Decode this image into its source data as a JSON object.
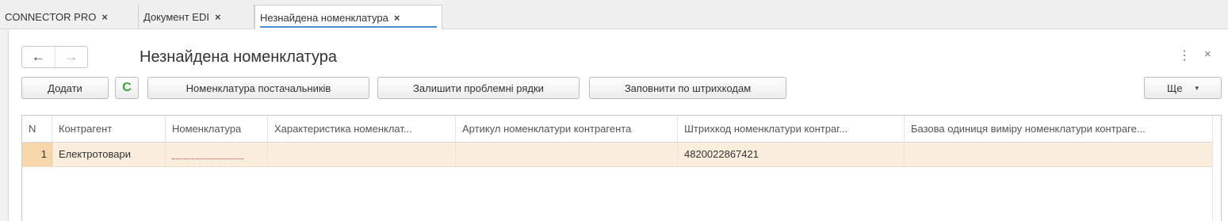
{
  "tabs": [
    {
      "label": "CONNECTOR PRO",
      "close": "×"
    },
    {
      "label": "Документ EDI",
      "close": "×"
    },
    {
      "label": "Незнайдена номенклатура",
      "close": "×"
    }
  ],
  "form": {
    "title": "Незнайдена номенклатура",
    "nav_back": "←",
    "nav_forward": "→",
    "menu_icon": "⋮",
    "close_icon": "×"
  },
  "toolbar": {
    "add": "Додати",
    "refresh_icon": "C",
    "supplier_nomenclature": "Номенклатура постачальників",
    "keep_problem_rows": "Залишити проблемні рядки",
    "fill_by_barcodes": "Заповнити по штрихкодам",
    "more": "Ще",
    "more_caret": "▾"
  },
  "table": {
    "columns": [
      "N",
      "Контрагент",
      "Номенклатура",
      "Характеристика номенклат...",
      "Артикул номенклатури контрагента",
      "Штрихкод номенклатури контраг...",
      "Базова одиниця виміру номенклатури контраге..."
    ],
    "rows": [
      {
        "n": "1",
        "counterparty": "Електротовари",
        "nomenclature": "",
        "characteristic": "",
        "article": "",
        "barcode": "4820022867421",
        "unit": ""
      }
    ]
  },
  "colors": {
    "accent": "#4a8fd0",
    "row_highlight": "#fbeedc",
    "row_number_highlight": "#f7d8ad",
    "refresh_green": "#3aa33a",
    "error_underline": "#d64040"
  }
}
